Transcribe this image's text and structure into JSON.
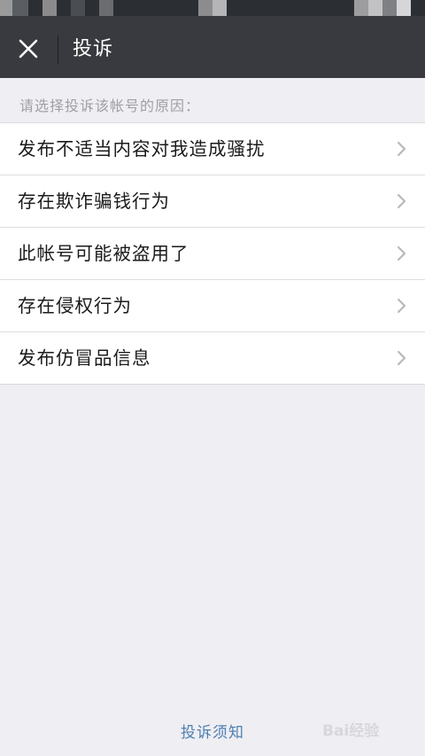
{
  "header": {
    "title": "投诉",
    "close_icon": "close-icon"
  },
  "prompt": "请选择投诉该帐号的原因：",
  "reasons": [
    {
      "label": "发布不适当内容对我造成骚扰"
    },
    {
      "label": "存在欺诈骗钱行为"
    },
    {
      "label": "此帐号可能被盗用了"
    },
    {
      "label": "存在侵权行为"
    },
    {
      "label": "发布仿冒品信息"
    }
  ],
  "footer": {
    "link_label": "投诉须知"
  },
  "watermark": {
    "text": "Bai经验"
  },
  "colors": {
    "header_bg": "#393a3f",
    "page_bg": "#efeef3",
    "link": "#4e7fb0"
  }
}
